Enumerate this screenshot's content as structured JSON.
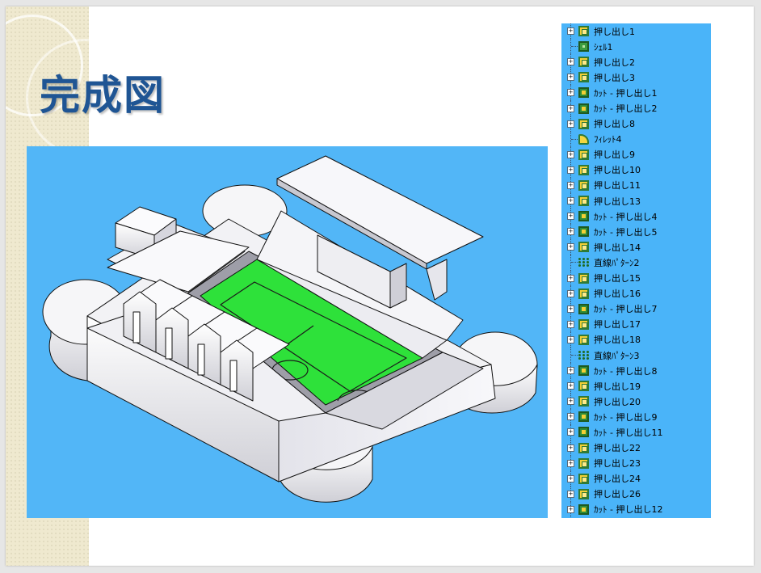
{
  "slide": {
    "title": "完成図"
  },
  "model_view": {
    "background_color": "#52b6f7",
    "pitch_color": "#2ee13a",
    "structure_color": "#f4f4f6"
  },
  "feature_tree": {
    "background_color": "#4ab4f9",
    "items": [
      {
        "label": "押し出し1",
        "icon": "extrude-icon",
        "expandable": true
      },
      {
        "label": "ｼｪﾙ1",
        "icon": "shell-icon",
        "expandable": false
      },
      {
        "label": "押し出し2",
        "icon": "extrude-icon",
        "expandable": true
      },
      {
        "label": "押し出し3",
        "icon": "extrude-icon",
        "expandable": true
      },
      {
        "label": "ｶｯﾄ - 押し出し1",
        "icon": "cut-extrude-icon",
        "expandable": true
      },
      {
        "label": "ｶｯﾄ - 押し出し2",
        "icon": "cut-extrude-icon",
        "expandable": true
      },
      {
        "label": "押し出し8",
        "icon": "extrude-icon",
        "expandable": true
      },
      {
        "label": "ﾌｨﾚｯﾄ4",
        "icon": "fillet-icon",
        "expandable": false
      },
      {
        "label": "押し出し9",
        "icon": "extrude-icon",
        "expandable": true
      },
      {
        "label": "押し出し10",
        "icon": "extrude-icon",
        "expandable": true
      },
      {
        "label": "押し出し11",
        "icon": "extrude-icon",
        "expandable": true
      },
      {
        "label": "押し出し13",
        "icon": "extrude-icon",
        "expandable": true
      },
      {
        "label": "ｶｯﾄ - 押し出し4",
        "icon": "cut-extrude-icon",
        "expandable": true
      },
      {
        "label": "ｶｯﾄ - 押し出し5",
        "icon": "cut-extrude-icon",
        "expandable": true
      },
      {
        "label": "押し出し14",
        "icon": "extrude-icon",
        "expandable": true
      },
      {
        "label": "直線ﾊﾟﾀｰﾝ2",
        "icon": "linear-pattern-icon",
        "expandable": false
      },
      {
        "label": "押し出し15",
        "icon": "extrude-icon",
        "expandable": true
      },
      {
        "label": "押し出し16",
        "icon": "extrude-icon",
        "expandable": true
      },
      {
        "label": "ｶｯﾄ - 押し出し7",
        "icon": "cut-extrude-icon",
        "expandable": true
      },
      {
        "label": "押し出し17",
        "icon": "extrude-icon",
        "expandable": true
      },
      {
        "label": "押し出し18",
        "icon": "extrude-icon",
        "expandable": true
      },
      {
        "label": "直線ﾊﾟﾀｰﾝ3",
        "icon": "linear-pattern-icon",
        "expandable": false
      },
      {
        "label": "ｶｯﾄ - 押し出し8",
        "icon": "cut-extrude-icon",
        "expandable": true
      },
      {
        "label": "押し出し19",
        "icon": "extrude-icon",
        "expandable": true
      },
      {
        "label": "押し出し20",
        "icon": "extrude-icon",
        "expandable": true
      },
      {
        "label": "ｶｯﾄ - 押し出し9",
        "icon": "cut-extrude-icon",
        "expandable": true
      },
      {
        "label": "ｶｯﾄ - 押し出し11",
        "icon": "cut-extrude-icon",
        "expandable": true
      },
      {
        "label": "押し出し22",
        "icon": "extrude-icon",
        "expandable": true
      },
      {
        "label": "押し出し23",
        "icon": "extrude-icon",
        "expandable": true
      },
      {
        "label": "押し出し24",
        "icon": "extrude-icon",
        "expandable": true
      },
      {
        "label": "押し出し26",
        "icon": "extrude-icon",
        "expandable": true
      },
      {
        "label": "ｶｯﾄ - 押し出し12",
        "icon": "cut-extrude-icon",
        "expandable": true
      }
    ]
  }
}
